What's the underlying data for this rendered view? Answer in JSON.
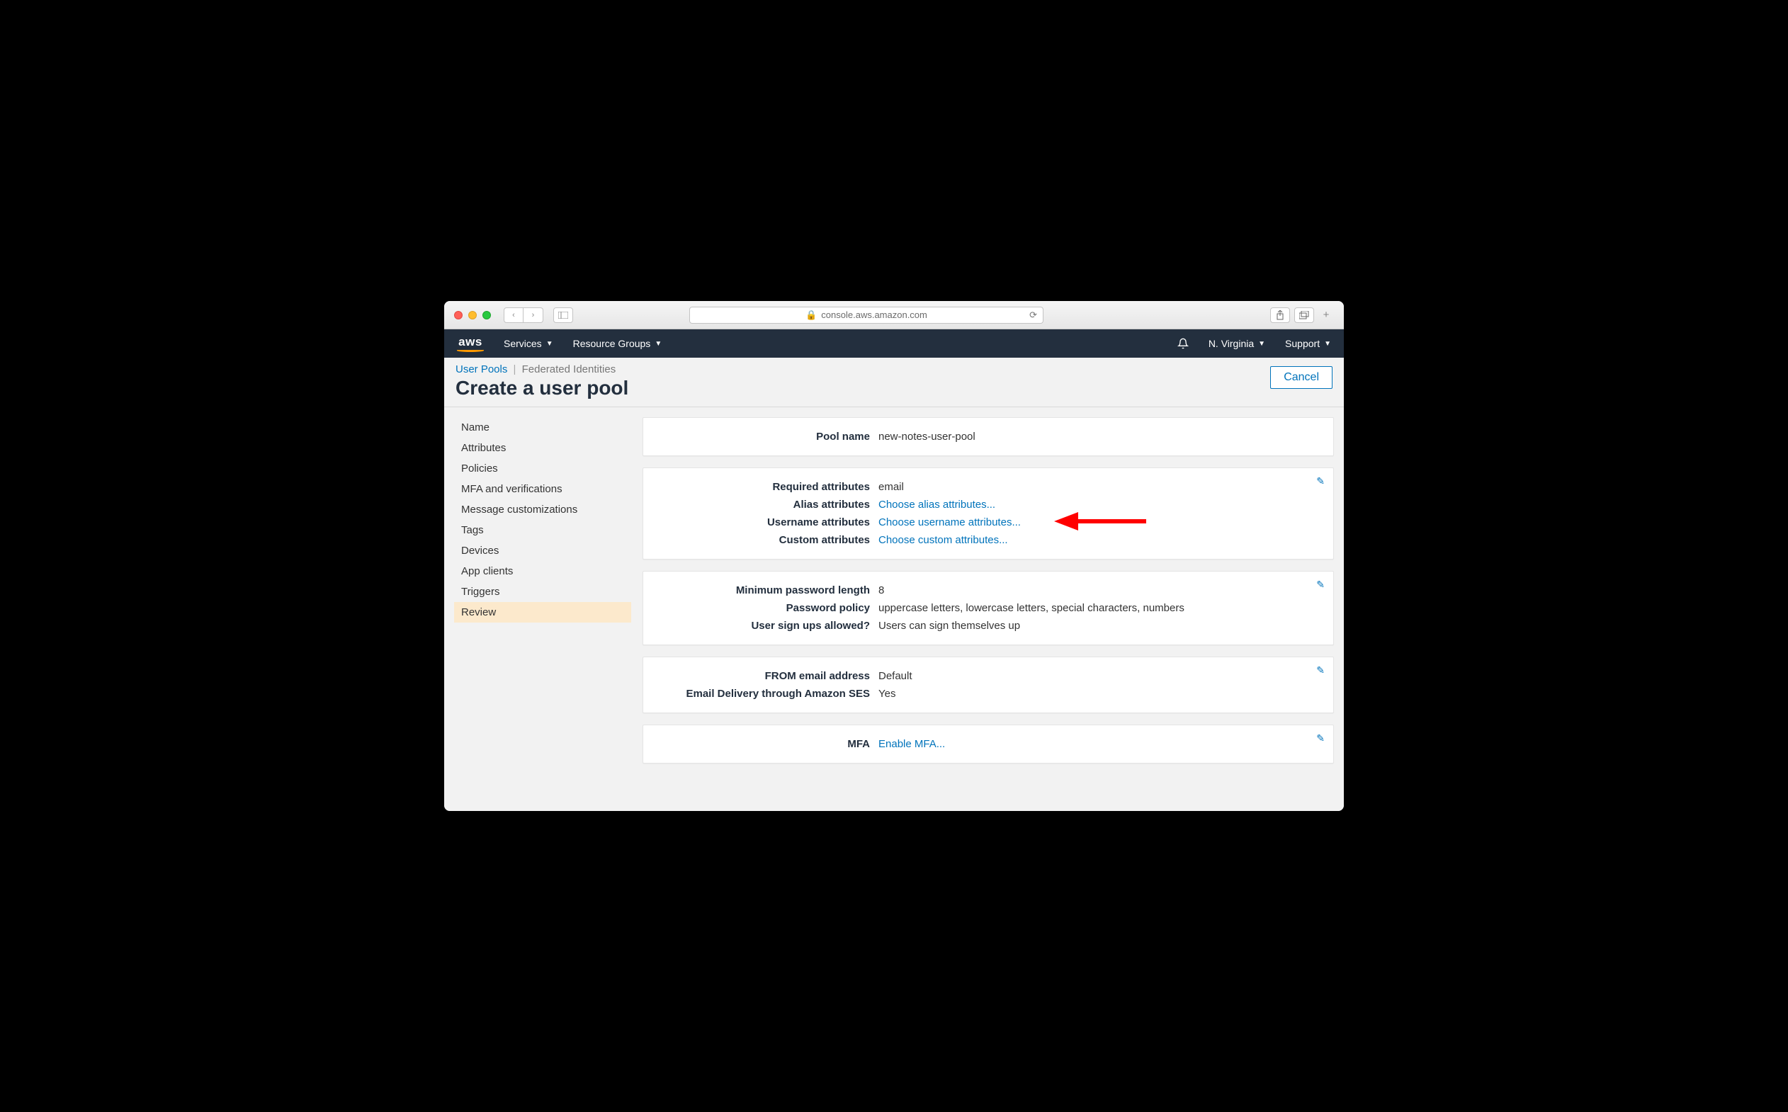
{
  "browser": {
    "url": "console.aws.amazon.com"
  },
  "nav": {
    "services": "Services",
    "groups": "Resource Groups",
    "region": "N. Virginia",
    "support": "Support"
  },
  "crumbs": {
    "link": "User Pools",
    "muted": "Federated Identities"
  },
  "title": "Create a user pool",
  "cancel": "Cancel",
  "sidebar": {
    "items": [
      "Name",
      "Attributes",
      "Policies",
      "MFA and verifications",
      "Message customizations",
      "Tags",
      "Devices",
      "App clients",
      "Triggers",
      "Review"
    ],
    "activeIndex": 9
  },
  "cards": [
    {
      "edit": false,
      "rows": [
        {
          "label": "Pool name",
          "value": "new-notes-user-pool",
          "link": false
        }
      ]
    },
    {
      "edit": true,
      "rows": [
        {
          "label": "Required attributes",
          "value": "email",
          "link": false
        },
        {
          "label": "Alias attributes",
          "value": "Choose alias attributes...",
          "link": true
        },
        {
          "label": "Username attributes",
          "value": "Choose username attributes...",
          "link": true,
          "arrow": true
        },
        {
          "label": "Custom attributes",
          "value": "Choose custom attributes...",
          "link": true
        }
      ]
    },
    {
      "edit": true,
      "rows": [
        {
          "label": "Minimum password length",
          "value": "8",
          "link": false
        },
        {
          "label": "Password policy",
          "value": "uppercase letters, lowercase letters, special characters, numbers",
          "link": false
        },
        {
          "label": "User sign ups allowed?",
          "value": "Users can sign themselves up",
          "link": false
        }
      ]
    },
    {
      "edit": true,
      "rows": [
        {
          "label": "FROM email address",
          "value": "Default",
          "link": false
        },
        {
          "label": "Email Delivery through Amazon SES",
          "value": "Yes",
          "link": false
        }
      ]
    },
    {
      "edit": true,
      "rows": [
        {
          "label": "MFA",
          "value": "Enable MFA...",
          "link": true
        }
      ]
    }
  ]
}
